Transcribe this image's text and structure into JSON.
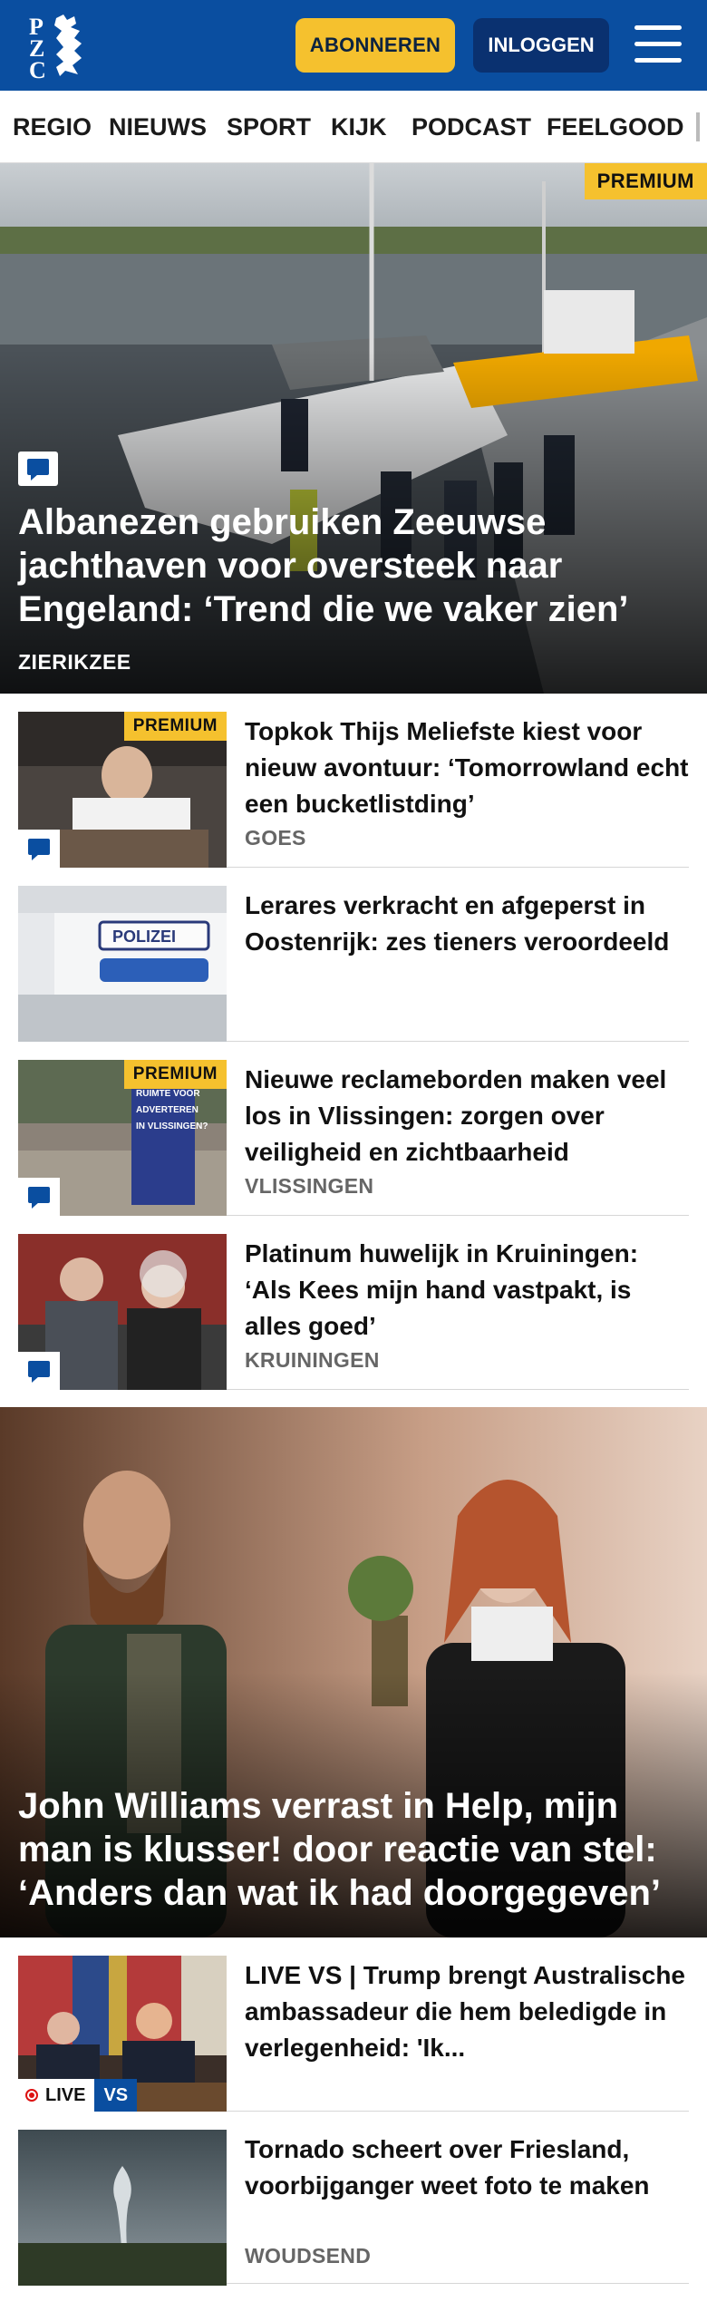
{
  "header": {
    "logo_text": "PZC",
    "subscribe_label": "ABONNEREN",
    "login_label": "INLOGGEN",
    "brand_color": "#0a4ea0",
    "accent_color": "#f5c12e"
  },
  "nav": {
    "items": [
      "REGIO",
      "NIEUWS",
      "SPORT",
      "KIJK",
      "PODCAST",
      "FEELGOOD"
    ]
  },
  "hero": {
    "badge": "PREMIUM",
    "title": "Albanezen gebruiken Zeeuwse jachthaven voor oversteek naar Engeland: ‘Trend die we vaker zien’",
    "region": "ZIERIKZEE",
    "icon": "comment-icon"
  },
  "articles": [
    {
      "title": "Topkok Thijs Meliefste kiest voor nieuw avontuur: ‘Tomorrowland echt een bucketlistding’",
      "region": "GOES",
      "badge": "PREMIUM"
    },
    {
      "title": "Lerares verkracht en afgeperst in Oostenrijk: zes tieners veroor­deeld",
      "region": "",
      "badge": ""
    },
    {
      "title": "Nieuwe reclameborden maken veel los in Vlissingen: zorgen over veiligheid en zichtbaarheid",
      "region": "VLISSINGEN",
      "badge": "PREMIUM",
      "sign_text": "RUIMTE VOOR ADVERTEREN IN VLISSINGEN?"
    },
    {
      "title": "Platinum huwelijk in Kruiningen: ‘Als Kees mijn hand vastpakt, is alles goed’",
      "region": "KRUININGEN",
      "badge": ""
    }
  ],
  "feature": {
    "title": "John Williams verrast in Help, mijn man is klusser! door reactie van stel: ‘Anders dan wat ik had doorgegeven’"
  },
  "articles2": [
    {
      "title": "LIVE VS | Trump brengt Australi­sche ambassadeur die hem beledigde in verlegenheid: 'Ik...",
      "live_label": "LIVE",
      "vs_label": "VS"
    },
    {
      "title": "Tornado scheert over Friesland, voorbijganger weet foto te maken",
      "region": "WOUDSEND"
    }
  ]
}
